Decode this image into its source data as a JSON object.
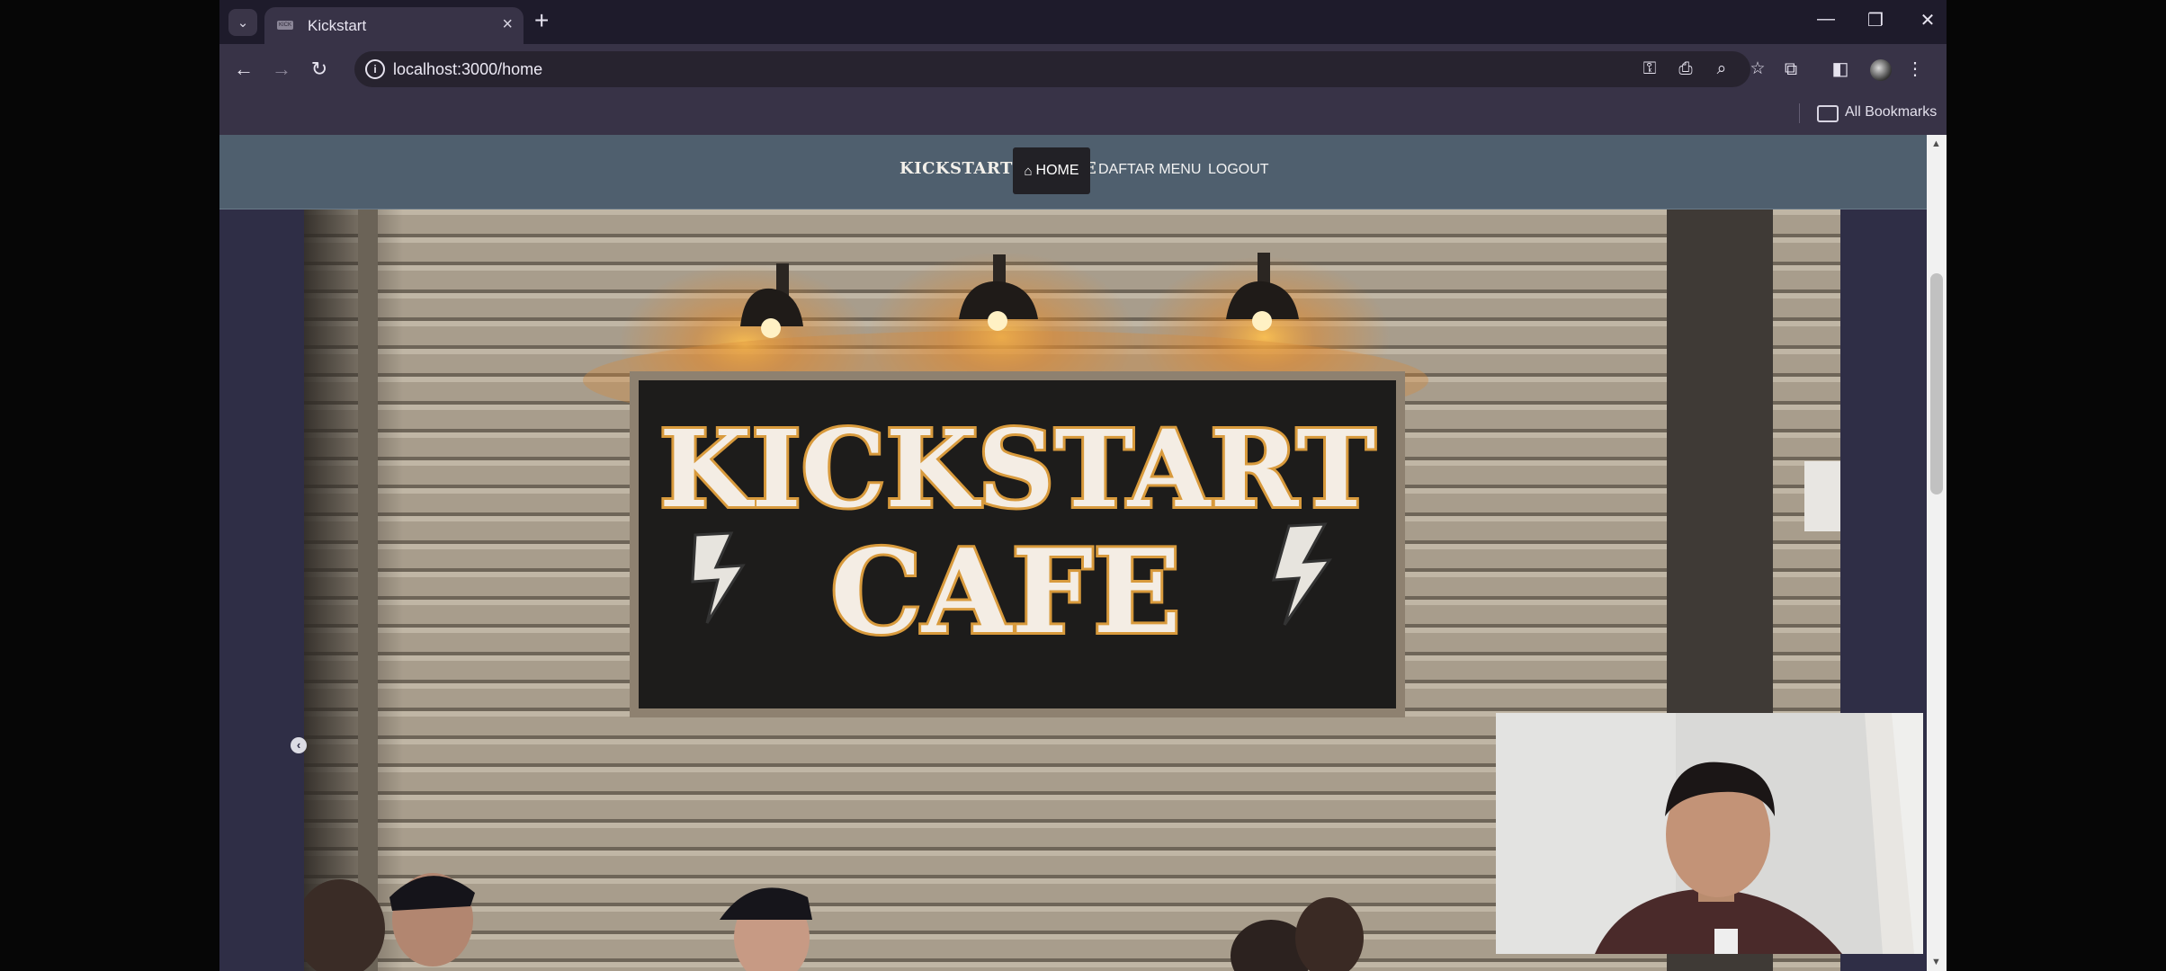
{
  "browser": {
    "tab": {
      "title": "Kickstart",
      "favicon_text": "KICK"
    },
    "tab_search_icon": "chevron-down-icon",
    "new_tab_icon": "plus-icon",
    "window_controls": [
      "minimize-icon",
      "restore-icon",
      "close-icon"
    ],
    "address_bar": {
      "url": "localhost:3000/home"
    },
    "bookmarks_bar": {
      "all_bookmarks_label": "All Bookmarks"
    }
  },
  "page": {
    "navbar": {
      "brand": "KICKSTART ⚡ CAFE",
      "items": [
        {
          "label": "HOME",
          "icon": "home-icon",
          "active": true
        },
        {
          "label": "DAFTAR MENU",
          "active": false
        },
        {
          "label": "LOGOUT",
          "active": false
        }
      ]
    },
    "hero": {
      "sign_line1": "KICKSTART",
      "sign_line2": "CAFE"
    },
    "carousel_prev_icon": "chevron-left-icon"
  },
  "colors": {
    "navbar_bg": "#4f5f6e",
    "active_nav_bg": "#222126",
    "page_bg": "#2f2e46",
    "browser_chrome": "#383347",
    "sign_text": "#f4ede4",
    "sign_outline": "#d89a3c"
  }
}
